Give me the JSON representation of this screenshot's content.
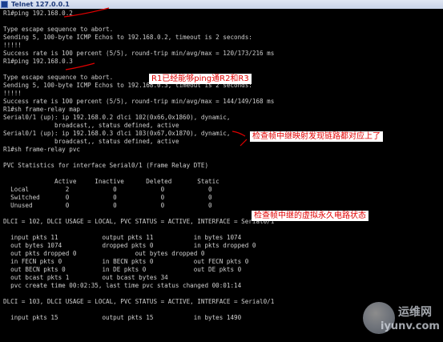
{
  "window": {
    "title": "Telnet 127.0.0.1"
  },
  "terminal_lines": [
    "R1#ping 192.168.0.2",
    "",
    "Type escape sequence to abort.",
    "Sending 5, 100-byte ICMP Echos to 192.168.0.2, timeout is 2 seconds:",
    "!!!!!",
    "Success rate is 100 percent (5/5), round-trip min/avg/max = 120/173/216 ms",
    "R1#ping 192.168.0.3",
    "",
    "Type escape sequence to abort.",
    "Sending 5, 100-byte ICMP Echos to 192.168.0.3, timeout is 2 seconds:",
    "!!!!!",
    "Success rate is 100 percent (5/5), round-trip min/avg/max = 144/149/168 ms",
    "R1#sh frame-relay map",
    "Serial0/1 (up): ip 192.168.0.2 dlci 102(0x66,0x1860), dynamic,",
    "              broadcast,, status defined, active",
    "Serial0/1 (up): ip 192.168.0.3 dlci 103(0x67,0x1870), dynamic,",
    "              broadcast,, status defined, active",
    "R1#sh frame-relay pvc",
    "",
    "PVC Statistics for interface Serial0/1 (Frame Relay DTE)",
    "",
    "              Active     Inactive      Deleted       Static",
    "  Local          2            0            0            0",
    "  Switched       0            0            0            0",
    "  Unused         0            0            0            0",
    "",
    "DLCI = 102, DLCI USAGE = LOCAL, PVC STATUS = ACTIVE, INTERFACE = Serial0/1",
    "",
    "  input pkts 11            output pkts 11           in bytes 1074",
    "  out bytes 1074           dropped pkts 0           in pkts dropped 0",
    "  out pkts dropped 0                out bytes dropped 0",
    "  in FECN pkts 0           in BECN pkts 0           out FECN pkts 0",
    "  out BECN pkts 0          in DE pkts 0             out DE pkts 0",
    "  out bcast pkts 1         out bcast bytes 34",
    "  pvc create time 00:02:35, last time pvc status changed 00:01:14",
    "",
    "DLCI = 103, DLCI USAGE = LOCAL, PVC STATUS = ACTIVE, INTERFACE = Serial0/1",
    "",
    "  input pkts 15            output pkts 15           in bytes 1490"
  ],
  "annotations": {
    "ping_note": "R1已经能够ping通R2和R3",
    "map_note": "检查帧中继映射发现链路都对应上了",
    "pvc_note": "检查帧中继的虚拟永久电路状态"
  },
  "watermark": {
    "cn": "运维网",
    "en": "iyunv.com"
  },
  "colors": {
    "terminal_bg": "#000000",
    "terminal_text": "#cfcfcf",
    "annotation_text": "#e00000",
    "arrow": "#e00000"
  }
}
